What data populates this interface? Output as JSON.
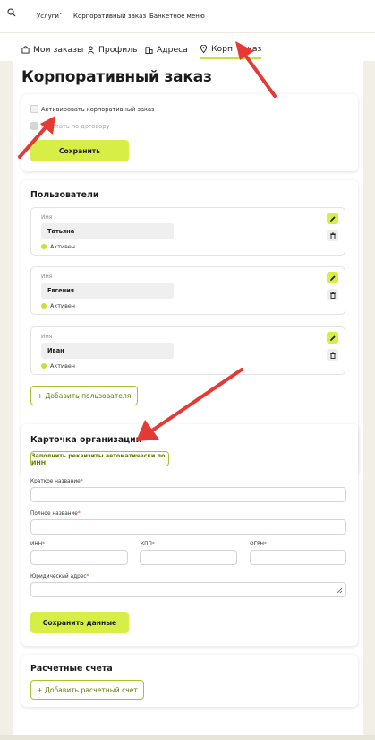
{
  "topnav": {
    "links": [
      "Услуги",
      "Корпоративный заказ",
      "Банкетное меню"
    ]
  },
  "tabs": [
    {
      "label": "Мои заказы",
      "icon": "bag-icon"
    },
    {
      "label": "Профиль",
      "icon": "user-icon"
    },
    {
      "label": "Адреса",
      "icon": "building-icon"
    },
    {
      "label": "Корп. заказ",
      "icon": "location-pin-icon",
      "active": true
    }
  ],
  "page": {
    "title": "Корпоративный заказ"
  },
  "corporate": {
    "activate_label": "Активировать корпоративный заказ",
    "contract_label": "Работать по договору",
    "save_label": "Сохранить"
  },
  "users": {
    "title": "Пользователи",
    "field_label": "Имя",
    "items": [
      {
        "name": "Татьяна",
        "status": "Активен"
      },
      {
        "name": "Евгения",
        "status": "Активен"
      },
      {
        "name": "Иван",
        "status": "Активен"
      }
    ],
    "add_label": "+ Добавить пользователя"
  },
  "org": {
    "title": "Карточка организации",
    "autofill_label": "Заполнить реквизиты автоматически по ИНН",
    "short_name_label": "Краткое название",
    "full_name_label": "Полное название",
    "inn_label": "ИНН",
    "kpp_label": "КПП",
    "ogrn_label": "ОГРН",
    "address_label": "Юридический адрес",
    "required_mark": "*",
    "save_label": "Сохранить данные"
  },
  "accounts": {
    "title": "Расчетные счета",
    "add_label": "+ Добавить расчетный счет"
  },
  "colors": {
    "accent": "#d7ee46",
    "accent_border": "#a9c230",
    "background": "#f1efe6",
    "arrow": "#e53935"
  }
}
